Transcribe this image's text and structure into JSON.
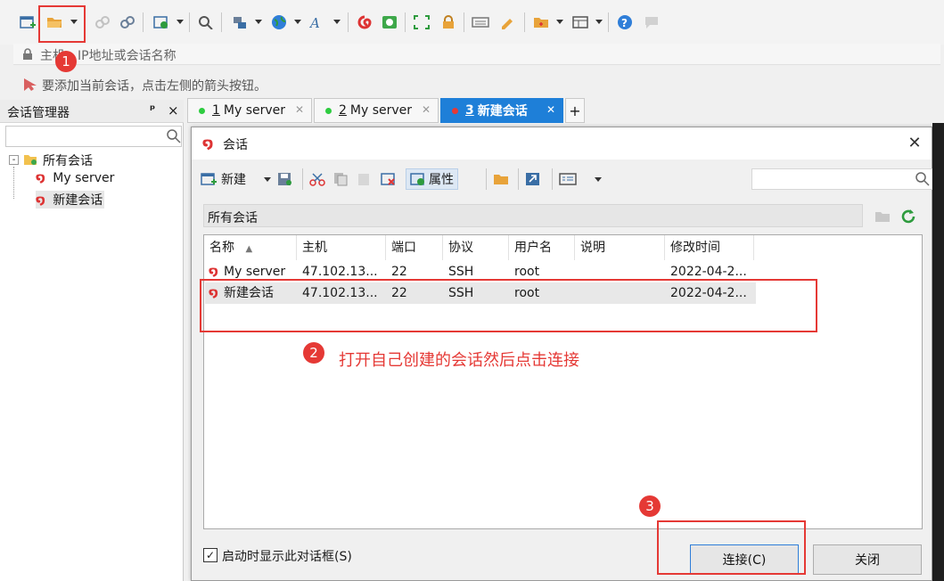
{
  "address": {
    "placeholder": "主机、IP地址或会话名称"
  },
  "hint": {
    "text": "要添加当前会话，点击左侧的箭头按钮。"
  },
  "panel": {
    "title": "会话管理器",
    "pin": "ᵖ",
    "close": "×",
    "tree": {
      "root": "所有会话",
      "items": [
        "My server",
        "新建会话"
      ]
    }
  },
  "tabs": [
    {
      "index": "1",
      "label": "My server",
      "dot_color": "#2ecc40"
    },
    {
      "index": "2",
      "label": "My server",
      "dot_color": "#2ecc40"
    },
    {
      "index": "3",
      "label": "新建会话",
      "dot_color": "#e53935"
    }
  ],
  "tab_add": "+",
  "dialog": {
    "title": "会话",
    "toolbar": {
      "new_label": "新建",
      "props_label": "属性"
    },
    "folder": "所有会话",
    "columns": [
      "名称",
      "主机",
      "端口",
      "协议",
      "用户名",
      "说明",
      "修改时间"
    ],
    "rows": [
      {
        "name": "My server",
        "host": "47.102.13...",
        "port": "22",
        "protocol": "SSH",
        "user": "root",
        "desc": "",
        "modified": "2022-04-2..."
      },
      {
        "name": "新建会话",
        "host": "47.102.13...",
        "port": "22",
        "protocol": "SSH",
        "user": "root",
        "desc": "",
        "modified": "2022-04-2..."
      }
    ],
    "checkbox_label": "启动时显示此对话框(S)",
    "checkbox_checked": true,
    "connect_label": "连接(C)",
    "close_label": "关闭"
  },
  "annotations": {
    "badge1": "1",
    "badge2": "2",
    "badge3": "3",
    "text2": "打开自己创建的会话然后点击连接",
    "color": "#e53935"
  }
}
